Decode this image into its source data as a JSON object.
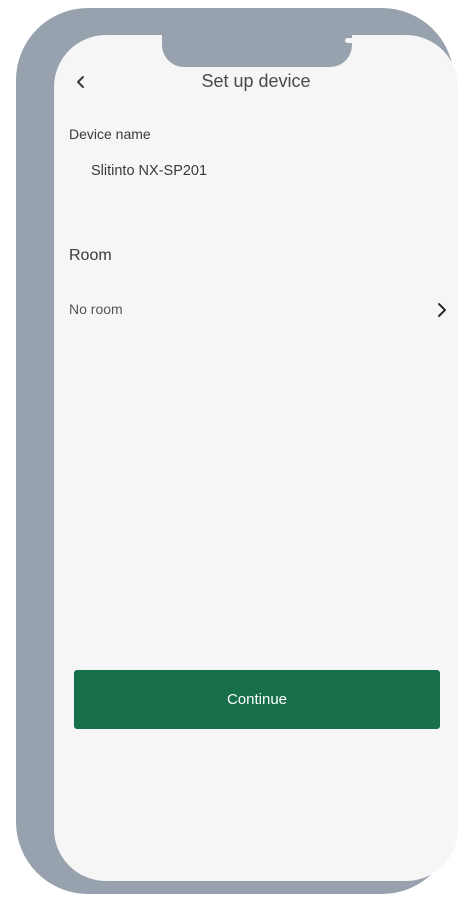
{
  "header": {
    "back_icon": "chevron-left-icon",
    "title": "Set up device"
  },
  "device_name": {
    "label": "Device name",
    "value": "Slitinto NX-SP201"
  },
  "room": {
    "heading": "Room",
    "selected": "No room",
    "chevron_icon": "chevron-right-icon"
  },
  "actions": {
    "continue_label": "Continue"
  },
  "colors": {
    "accent": "#18704a",
    "frame": "#97a2ae",
    "screen_background": "#f6f6f6"
  }
}
